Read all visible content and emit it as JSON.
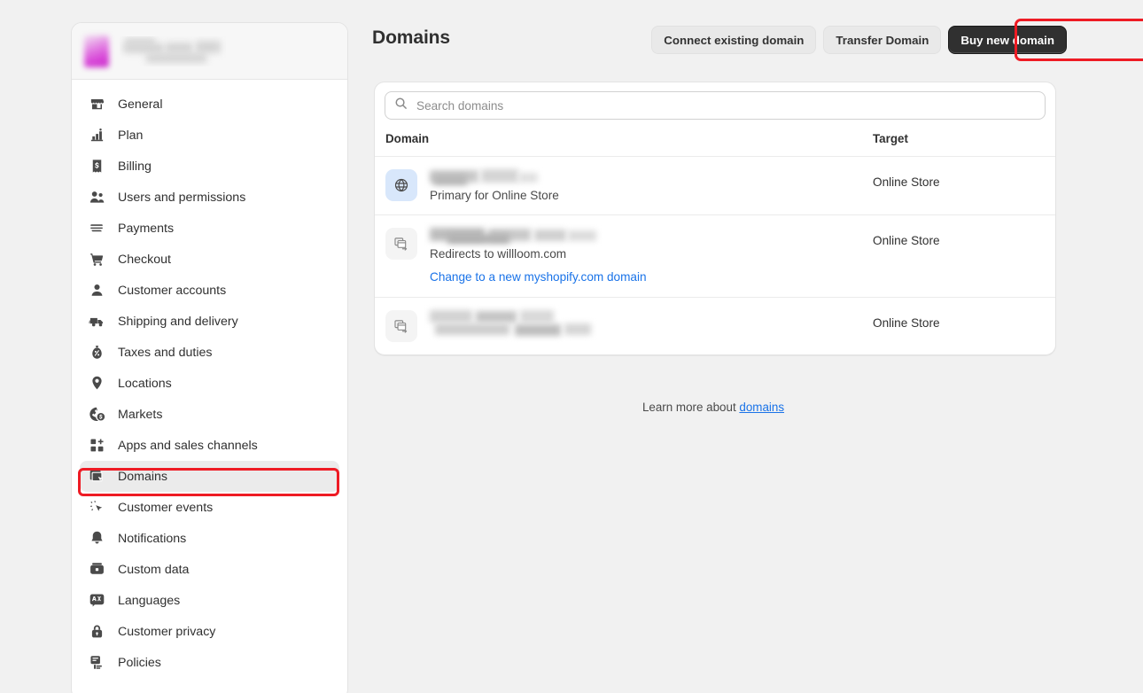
{
  "sidebar": {
    "store": {
      "name_redacted": true
    },
    "items": [
      {
        "label": "General",
        "icon": "storefront-icon",
        "selected": false
      },
      {
        "label": "Plan",
        "icon": "chart-bars-icon",
        "selected": false
      },
      {
        "label": "Billing",
        "icon": "receipt-dollar-icon",
        "selected": false
      },
      {
        "label": "Users and permissions",
        "icon": "users-icon",
        "selected": false
      },
      {
        "label": "Payments",
        "icon": "payments-card-icon",
        "selected": false
      },
      {
        "label": "Checkout",
        "icon": "shopping-cart-icon",
        "selected": false
      },
      {
        "label": "Customer accounts",
        "icon": "person-icon",
        "selected": false
      },
      {
        "label": "Shipping and delivery",
        "icon": "delivery-truck-icon",
        "selected": false
      },
      {
        "label": "Taxes and duties",
        "icon": "tax-bag-percent-icon",
        "selected": false
      },
      {
        "label": "Locations",
        "icon": "map-pin-icon",
        "selected": false
      },
      {
        "label": "Markets",
        "icon": "globe-dollar-icon",
        "selected": false
      },
      {
        "label": "Apps and sales channels",
        "icon": "apps-grid-plus-icon",
        "selected": false
      },
      {
        "label": "Domains",
        "icon": "domains-window-icon",
        "selected": true
      },
      {
        "label": "Customer events",
        "icon": "cursor-sparkle-icon",
        "selected": false
      },
      {
        "label": "Notifications",
        "icon": "bell-icon",
        "selected": false
      },
      {
        "label": "Custom data",
        "icon": "database-icon",
        "selected": false
      },
      {
        "label": "Languages",
        "icon": "translate-icon",
        "selected": false
      },
      {
        "label": "Customer privacy",
        "icon": "lock-icon",
        "selected": false
      },
      {
        "label": "Policies",
        "icon": "policy-document-icon",
        "selected": false
      }
    ]
  },
  "header": {
    "title": "Domains",
    "actions": [
      {
        "label": "Connect existing domain",
        "style": "secondary"
      },
      {
        "label": "Transfer Domain",
        "style": "secondary"
      },
      {
        "label": "Buy new domain",
        "style": "primary"
      }
    ]
  },
  "search": {
    "placeholder": "Search domains",
    "value": "",
    "icon": "search-icon"
  },
  "table": {
    "columns": {
      "domain": "Domain",
      "target": "Target"
    },
    "rows": [
      {
        "icon": "globe-icon",
        "icon_style": "blue",
        "domain_redacted": true,
        "subtitle": "Primary for Online Store",
        "link": null,
        "target": "Online Store"
      },
      {
        "icon": "domain-redirect-icon",
        "icon_style": "grey",
        "domain_redacted": true,
        "subtitle": "Redirects to willloom.com",
        "link": "Change to a new myshopify.com domain",
        "target": "Online Store"
      },
      {
        "icon": "domain-redirect-icon",
        "icon_style": "grey",
        "domain_redacted": true,
        "subtitle": "",
        "link": null,
        "target": "Online Store"
      }
    ]
  },
  "footer": {
    "text_before": "Learn more about ",
    "link_label": "domains"
  },
  "annotations": {
    "highlight_color": "#ee1b24",
    "boxes": [
      "header-actions",
      "sidebar-item-domains"
    ]
  },
  "colors": {
    "page_background": "#f1f1f1",
    "card_background": "#ffffff",
    "accent_link": "#1a73e8",
    "primary_button": "#303030",
    "secondary_button": "#e9e9e9",
    "selected_nav": "#ebebeb"
  }
}
